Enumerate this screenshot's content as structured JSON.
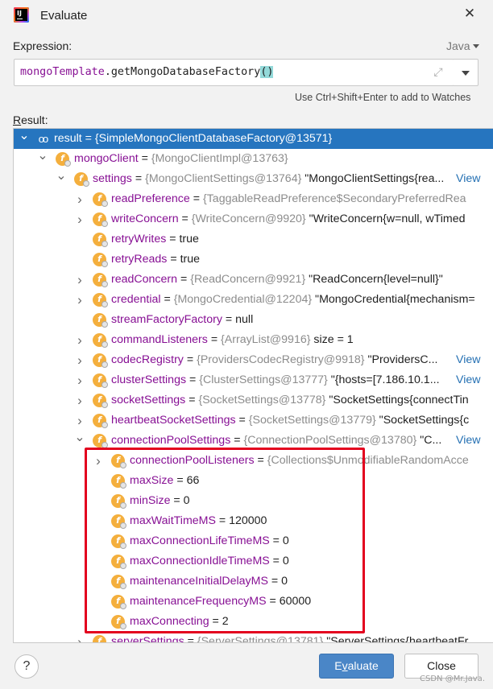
{
  "window": {
    "title": "Evaluate",
    "close_icon": "close-icon"
  },
  "expression": {
    "label": "Expression:",
    "language": "Java",
    "code_var": "mongoTemplate",
    "code_dot": ".",
    "code_method": "getMongoDatabaseFactory",
    "code_parens": "()",
    "hint": "Use Ctrl+Shift+Enter to add to Watches"
  },
  "result": {
    "label_prefix": "R",
    "label_rest": "esult:",
    "rows": [
      {
        "name": "result",
        "eq": " = ",
        "ref": "{SimpleMongoClientDatabaseFactory@13571}",
        "val": "",
        "view": "",
        "expanded": true,
        "selected": true,
        "icon": "watch-glasses-icon"
      },
      {
        "name": "mongoClient",
        "eq": " = ",
        "ref": "{MongoClientImpl@13763}",
        "val": "",
        "view": "",
        "expanded": true,
        "icon": "field-icon"
      },
      {
        "name": "settings",
        "eq": " = ",
        "ref": "{MongoClientSettings@13764}",
        "val": " \"MongoClientSettings{rea...",
        "view": "View",
        "expanded": true,
        "icon": "field-icon"
      },
      {
        "name": "readPreference",
        "eq": " = ",
        "ref": "{TaggableReadPreference$SecondaryPreferredRea",
        "val": "",
        "view": "",
        "collapsed": true,
        "icon": "field-icon"
      },
      {
        "name": "writeConcern",
        "eq": " = ",
        "ref": "{WriteConcern@9920}",
        "val": " \"WriteConcern{w=null, wTimed",
        "view": "",
        "collapsed": true,
        "icon": "field-icon"
      },
      {
        "name": "retryWrites",
        "eq": " = ",
        "ref": "",
        "val": "true",
        "view": "",
        "icon": "field-icon"
      },
      {
        "name": "retryReads",
        "eq": " = ",
        "ref": "",
        "val": "true",
        "view": "",
        "icon": "field-icon"
      },
      {
        "name": "readConcern",
        "eq": " = ",
        "ref": "{ReadConcern@9921}",
        "val": " \"ReadConcern{level=null}\"",
        "view": "",
        "collapsed": true,
        "icon": "field-icon"
      },
      {
        "name": "credential",
        "eq": " = ",
        "ref": "{MongoCredential@12204}",
        "val": " \"MongoCredential{mechanism=",
        "view": "",
        "collapsed": true,
        "icon": "field-icon"
      },
      {
        "name": "streamFactoryFactory",
        "eq": " = ",
        "ref": "",
        "val": "null",
        "view": "",
        "icon": "field-icon"
      },
      {
        "name": "commandListeners",
        "eq": " = ",
        "ref": "{ArrayList@9916}",
        "val": "  size = 1",
        "view": "",
        "collapsed": true,
        "icon": "field-icon"
      },
      {
        "name": "codecRegistry",
        "eq": " = ",
        "ref": "{ProvidersCodecRegistry@9918}",
        "val": " \"ProvidersC...",
        "view": "View",
        "collapsed": true,
        "icon": "field-icon"
      },
      {
        "name": "clusterSettings",
        "eq": " = ",
        "ref": "{ClusterSettings@13777}",
        "val": " \"{hosts=[7.186.10.1...",
        "view": "View",
        "collapsed": true,
        "icon": "field-icon"
      },
      {
        "name": "socketSettings",
        "eq": " = ",
        "ref": "{SocketSettings@13778}",
        "val": " \"SocketSettings{connectTin",
        "view": "",
        "collapsed": true,
        "icon": "field-icon"
      },
      {
        "name": "heartbeatSocketSettings",
        "eq": " = ",
        "ref": "{SocketSettings@13779}",
        "val": " \"SocketSettings{c",
        "view": "",
        "collapsed": true,
        "icon": "field-icon"
      },
      {
        "name": "connectionPoolSettings",
        "eq": " = ",
        "ref": "{ConnectionPoolSettings@13780}",
        "val": " \"C...",
        "view": "View",
        "expanded": true,
        "icon": "field-icon"
      },
      {
        "name": "connectionPoolListeners",
        "eq": " = ",
        "ref": "{Collections$UnmodifiableRandomAcce",
        "val": "",
        "view": "",
        "collapsed": true,
        "icon": "field-icon"
      },
      {
        "name": "maxSize",
        "eq": " = ",
        "ref": "",
        "val": "66",
        "view": "",
        "icon": "field-icon"
      },
      {
        "name": "minSize",
        "eq": " = ",
        "ref": "",
        "val": "0",
        "view": "",
        "icon": "field-icon"
      },
      {
        "name": "maxWaitTimeMS",
        "eq": " = ",
        "ref": "",
        "val": "120000",
        "view": "",
        "icon": "field-icon"
      },
      {
        "name": "maxConnectionLifeTimeMS",
        "eq": " = ",
        "ref": "",
        "val": "0",
        "view": "",
        "icon": "field-icon"
      },
      {
        "name": "maxConnectionIdleTimeMS",
        "eq": " = ",
        "ref": "",
        "val": "0",
        "view": "",
        "icon": "field-icon"
      },
      {
        "name": "maintenanceInitialDelayMS",
        "eq": " = ",
        "ref": "",
        "val": "0",
        "view": "",
        "icon": "field-icon"
      },
      {
        "name": "maintenanceFrequencyMS",
        "eq": " = ",
        "ref": "",
        "val": "60000",
        "view": "",
        "icon": "field-icon"
      },
      {
        "name": "maxConnecting",
        "eq": " = ",
        "ref": "",
        "val": "2",
        "view": "",
        "icon": "field-icon"
      },
      {
        "name": "serverSettings",
        "eq": " = ",
        "ref": "{ServerSettings@13781}",
        "val": " \"ServerSettings{heartbeatFr",
        "view": "",
        "collapsed": true,
        "icon": "field-icon"
      }
    ]
  },
  "buttons": {
    "help": "?",
    "evaluate_prefix": "E",
    "evaluate_underlined": "v",
    "evaluate_rest": "aluate",
    "close": "Close"
  },
  "watermark": "CSDN @Mr.Java."
}
